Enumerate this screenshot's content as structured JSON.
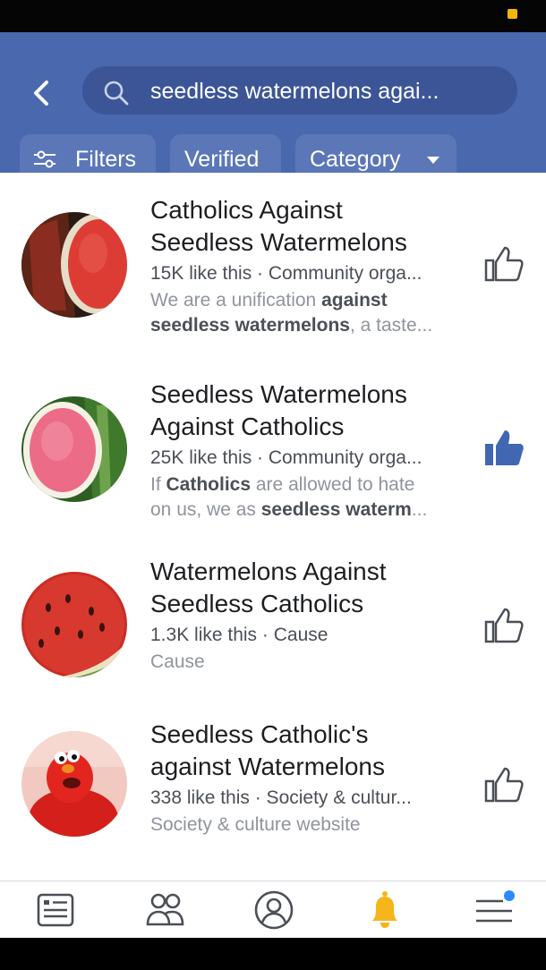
{
  "search": {
    "query": "seedless watermelons agai..."
  },
  "filters": {
    "filters_label": "Filters",
    "verified_label": "Verified",
    "category_label": "Category"
  },
  "results": [
    {
      "title_line1": "Catholics Against",
      "title_line2": "Seedless Watermelons",
      "meta": "15K like this · Community orga...",
      "desc_line1": "We are a unification against",
      "desc_line2": "seedless watermelons, a taste...",
      "liked": false
    },
    {
      "title_line1": "Seedless Watermelons",
      "title_line2": "Against Catholics",
      "meta": "25K like this · Community orga...",
      "desc_line1": "If Catholics are allowed to hate",
      "desc_line2": "on us, we as seedless waterm...",
      "liked": true
    },
    {
      "title_line1": "Watermelons Against",
      "title_line2": "Seedless Catholics",
      "meta": "1.3K like this · Cause",
      "desc_line1": "Cause",
      "liked": false
    },
    {
      "title_line1": "Seedless Catholic's",
      "title_line2": "against Watermelons",
      "meta": "338 like this · Society & cultur...",
      "desc_line1": "Society & culture website",
      "liked": false
    }
  ],
  "tabbar": {
    "items": [
      "news-feed-icon",
      "friends-icon",
      "profile-icon",
      "notifications-bell-icon",
      "menu-icon"
    ],
    "active": "notifications-bell-icon"
  },
  "colors": {
    "header": "#4a68ad",
    "search_field": "#3c5597",
    "chip": "#5b77b8",
    "like_active": "#4267b2",
    "bell": "#f5b51b",
    "menu_dot": "#2d88ff"
  }
}
